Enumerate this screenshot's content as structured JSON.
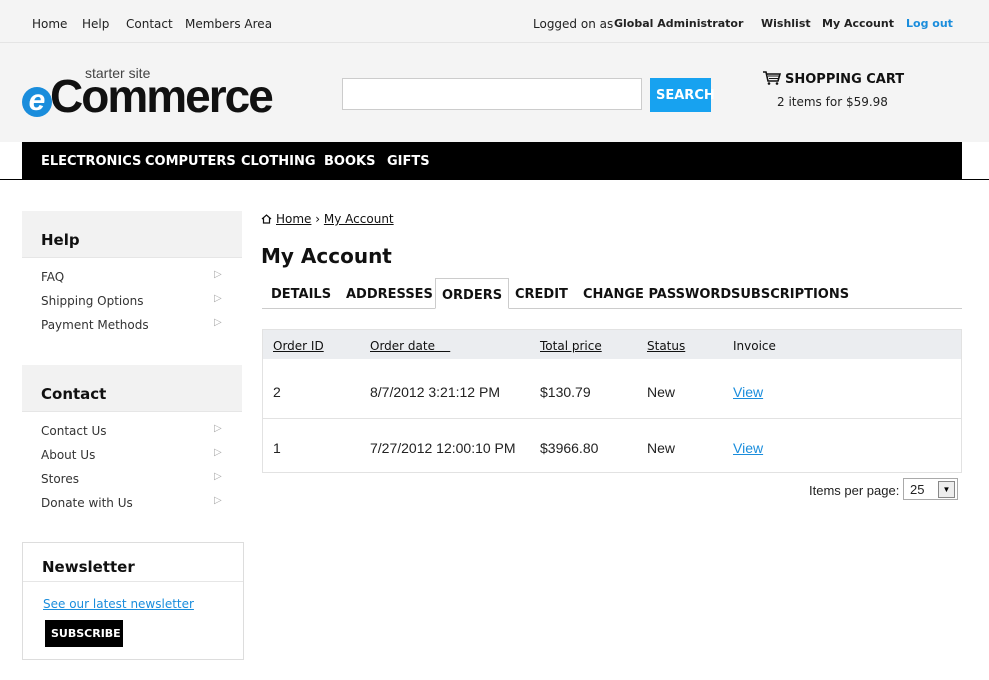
{
  "topbar": {
    "links": [
      "Home",
      "Help",
      "Contact",
      "Members Area"
    ],
    "logged_on_label": "Logged on as",
    "user": "Global Administrator",
    "wishlist": "Wishlist",
    "my_account": "My Account",
    "logout": "Log out"
  },
  "logo": {
    "starter": "starter site",
    "e": "e",
    "word": "Commerce"
  },
  "search": {
    "placeholder": "",
    "button": "SEARCH"
  },
  "cart": {
    "title": "SHOPPING CART",
    "summary": "2 items for $59.98"
  },
  "nav": [
    "ELECTRONICS",
    "COMPUTERS",
    "CLOTHING",
    "BOOKS",
    "GIFTS"
  ],
  "sidebar": {
    "help": {
      "title": "Help",
      "items": [
        "FAQ",
        "Shipping Options",
        "Payment Methods"
      ]
    },
    "contact": {
      "title": "Contact",
      "items": [
        "Contact Us",
        "About Us",
        "Stores",
        "Donate with Us"
      ]
    },
    "newsletter": {
      "title": "Newsletter",
      "link": "See our latest newsletter",
      "button": "SUBSCRIBE"
    }
  },
  "breadcrumb": {
    "home": "Home",
    "sep": "›",
    "current": "My Account"
  },
  "page_title": "My Account",
  "tabs": [
    "DETAILS",
    "ADDRESSES",
    "ORDERS",
    "CREDIT",
    "CHANGE PASSWORD",
    "SUBSCRIPTIONS"
  ],
  "active_tab": "ORDERS",
  "orders": {
    "columns": [
      "Order ID",
      "Order date",
      "Total price",
      "Status",
      "Invoice"
    ],
    "rows": [
      [
        "2",
        "8/7/2012 3:21:12 PM",
        "$130.79",
        "New",
        "View"
      ],
      [
        "1",
        "7/27/2012 12:00:10 PM",
        "$3966.80",
        "New",
        "View"
      ]
    ]
  },
  "pager": {
    "label": "Items per page:",
    "value": "25"
  },
  "colors": {
    "accent": "#17a2f0",
    "nav_bg": "#000000",
    "link": "#1a8ddc"
  }
}
